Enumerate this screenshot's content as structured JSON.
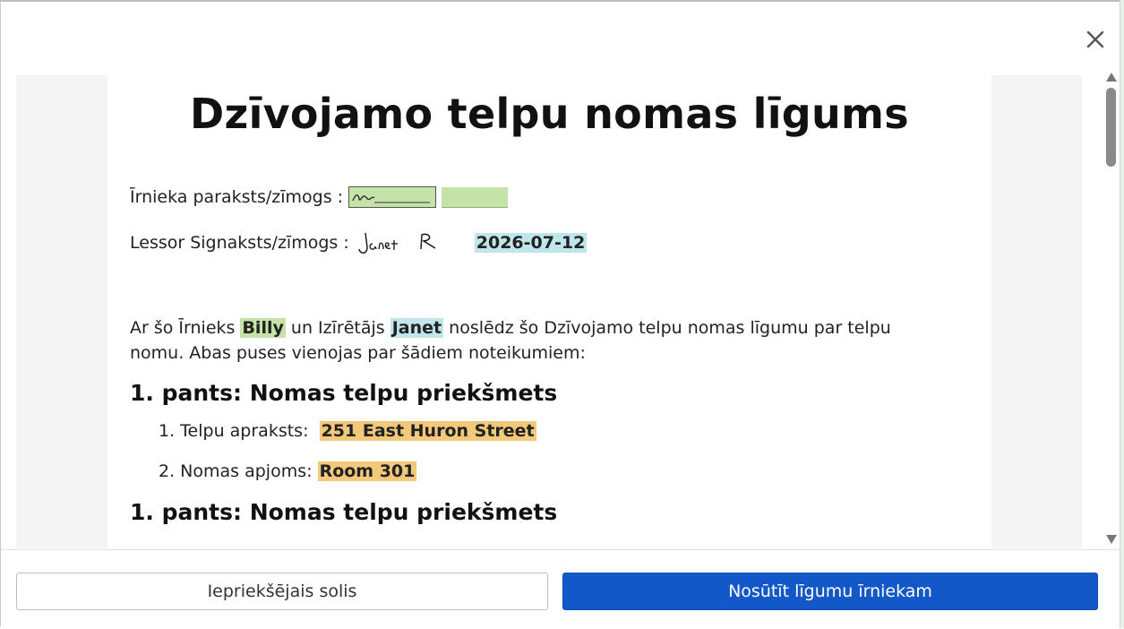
{
  "dialog": {
    "close_icon": "close-icon"
  },
  "document": {
    "title": "Dzīvojamo telpu nomas līgums",
    "tenant_signature_label": "Īrnieka paraksts/zīmogs :",
    "lessor_signature_label": "Lessor Signaksts/zīmogs :",
    "signature_date": "2026-07-12",
    "intro_before_tenant": "Ar šo Īrnieks",
    "tenant_name": "Billy",
    "intro_mid": "un Izīrētājs",
    "lessor_name": "Janet",
    "intro_after": "noslēdz šo Dzīvojamo telpu nomas līgumu par telpu nomu. Abas puses vienojas par šādiem noteikumiem:",
    "sections": [
      {
        "heading": "1. pants: Nomas telpu priekšmets",
        "items": [
          {
            "label": "1. Telpu apraksts:",
            "value": "251 East Huron Street"
          },
          {
            "label": "2. Nomas apjoms:",
            "value": "Room 301"
          }
        ]
      },
      {
        "heading": "1. pants: Nomas telpu priekšmets"
      }
    ]
  },
  "footer": {
    "prev_label": "Iepriekšējais solis",
    "send_label": "Nosūtīt līgumu īrniekam"
  },
  "colors": {
    "primary": "#1258c9",
    "highlight_green": "#c5e3a8",
    "highlight_cyan": "#bfe6ea",
    "highlight_orange": "#f2c97a"
  }
}
